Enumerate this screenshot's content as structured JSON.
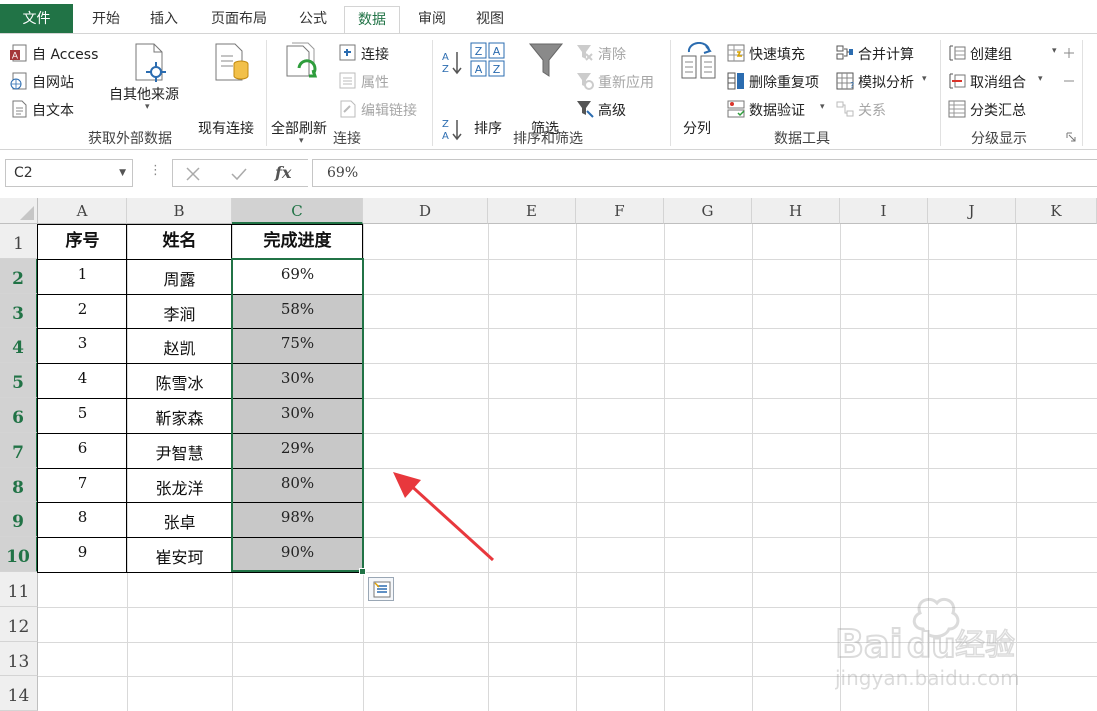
{
  "tabs": [
    "文件",
    "开始",
    "插入",
    "页面布局",
    "公式",
    "数据",
    "审阅",
    "视图"
  ],
  "active_tab": "数据",
  "ribbon": {
    "get_external": {
      "access": "自 Access",
      "web": "自网站",
      "text": "自文本",
      "other": "自其他来源",
      "existing": "现有连接",
      "group_label": "获取外部数据"
    },
    "connections": {
      "refresh_all": "全部刷新",
      "connections": "连接",
      "properties": "属性",
      "edit_links": "编辑链接",
      "group_label": "连接"
    },
    "sort_filter": {
      "sort": "排序",
      "filter": "筛选",
      "clear": "清除",
      "reapply": "重新应用",
      "advanced": "高级",
      "group_label": "排序和筛选"
    },
    "data_tools": {
      "split": "分列",
      "flash_fill": "快速填充",
      "remove_dup": "删除重复项",
      "validation": "数据验证",
      "consolidate": "合并计算",
      "what_if": "模拟分析",
      "relationships": "关系",
      "group_label": "数据工具"
    },
    "outline": {
      "group": "创建组",
      "ungroup": "取消组合",
      "subtotal": "分类汇总",
      "group_label": "分级显示"
    }
  },
  "formula_bar": {
    "name_box": "C2",
    "formula": "69%",
    "fx": "fx"
  },
  "columns": [
    "A",
    "B",
    "C",
    "D",
    "E",
    "F",
    "G",
    "H",
    "I",
    "J",
    "K"
  ],
  "rows": [
    "1",
    "2",
    "3",
    "4",
    "5",
    "6",
    "7",
    "8",
    "9",
    "10",
    "11",
    "12",
    "13",
    "14"
  ],
  "table": {
    "headers": [
      "序号",
      "姓名",
      "完成进度"
    ],
    "rows": [
      [
        "1",
        "周露",
        "69%"
      ],
      [
        "2",
        "李涧",
        "58%"
      ],
      [
        "3",
        "赵凯",
        "75%"
      ],
      [
        "4",
        "陈雪冰",
        "30%"
      ],
      [
        "5",
        "靳家森",
        "30%"
      ],
      [
        "6",
        "尹智慧",
        "29%"
      ],
      [
        "7",
        "张龙洋",
        "80%"
      ],
      [
        "8",
        "张卓",
        "98%"
      ],
      [
        "9",
        "崔安珂",
        "90%"
      ]
    ]
  },
  "colors": {
    "accent": "#217346",
    "selection_fill": "#c8c8c8",
    "arrow": "#e8383d"
  }
}
